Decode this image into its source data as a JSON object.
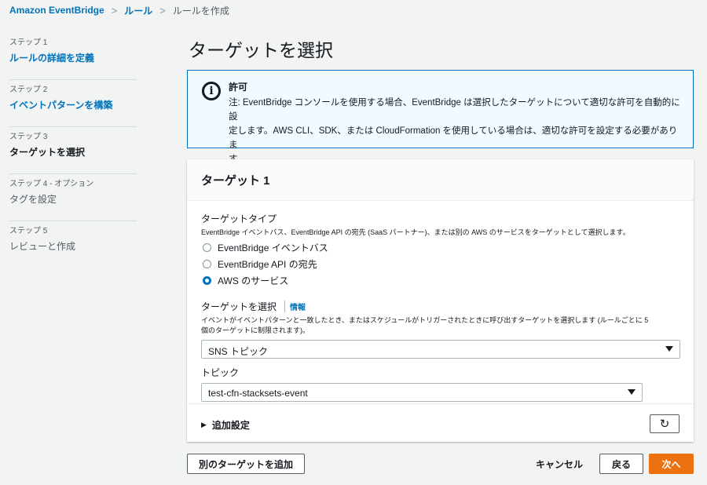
{
  "breadcrumb": {
    "items": [
      "Amazon EventBridge",
      "ルール",
      "ルールを作成"
    ]
  },
  "steps": [
    {
      "label": "ステップ 1",
      "title": "ルールの詳細を定義"
    },
    {
      "label": "ステップ 2",
      "title": "イベントパターンを構築"
    },
    {
      "label": "ステップ 3",
      "title": "ターゲットを選択"
    },
    {
      "label": "ステップ 4 - オプション",
      "title": "タグを設定"
    },
    {
      "label": "ステップ 5",
      "title": "レビューと作成"
    }
  ],
  "page_title": "ターゲットを選択",
  "alert": {
    "icon": "info-icon",
    "title": "許可",
    "line1": "注: EventBridge コンソールを使用する場合、EventBridge は選択したターゲットについて適切な許可を自動的に設",
    "line2": "定します。AWS CLI、SDK、または CloudFormation を使用している場合は、適切な許可を設定する必要がありま",
    "line3": "す。"
  },
  "target_panel": {
    "title": "ターゲット 1",
    "target_type": {
      "label": "ターゲットタイプ",
      "description": "EventBridge イベントバス、EventBridge API の宛先 (SaaS パートナー)、または別の AWS のサービスをターゲットとして選択します。",
      "options": [
        "EventBridge イベントバス",
        "EventBridge API の宛先",
        "AWS のサービス"
      ],
      "selected": "AWS のサービス"
    },
    "select_target": {
      "label": "ターゲットを選択",
      "info": "情報",
      "description_line1": "イベントがイベントパターンと一致したとき、またはスケジュールがトリガーされたときに呼び出すターゲットを選択します (ルールごとに 5",
      "description_line2": "個のターゲットに制限されます)。",
      "value": "SNS トピック"
    },
    "topic": {
      "label": "トピック",
      "value": "test-cfn-stacksets-event"
    },
    "additional_settings": "追加設定"
  },
  "footer": {
    "add_target": "別のターゲットを追加",
    "cancel": "キャンセル",
    "back": "戻る",
    "next": "次へ"
  },
  "colors": {
    "link": "#0073bb",
    "primary": "#ec7211",
    "alert_bg": "#f1faff"
  }
}
